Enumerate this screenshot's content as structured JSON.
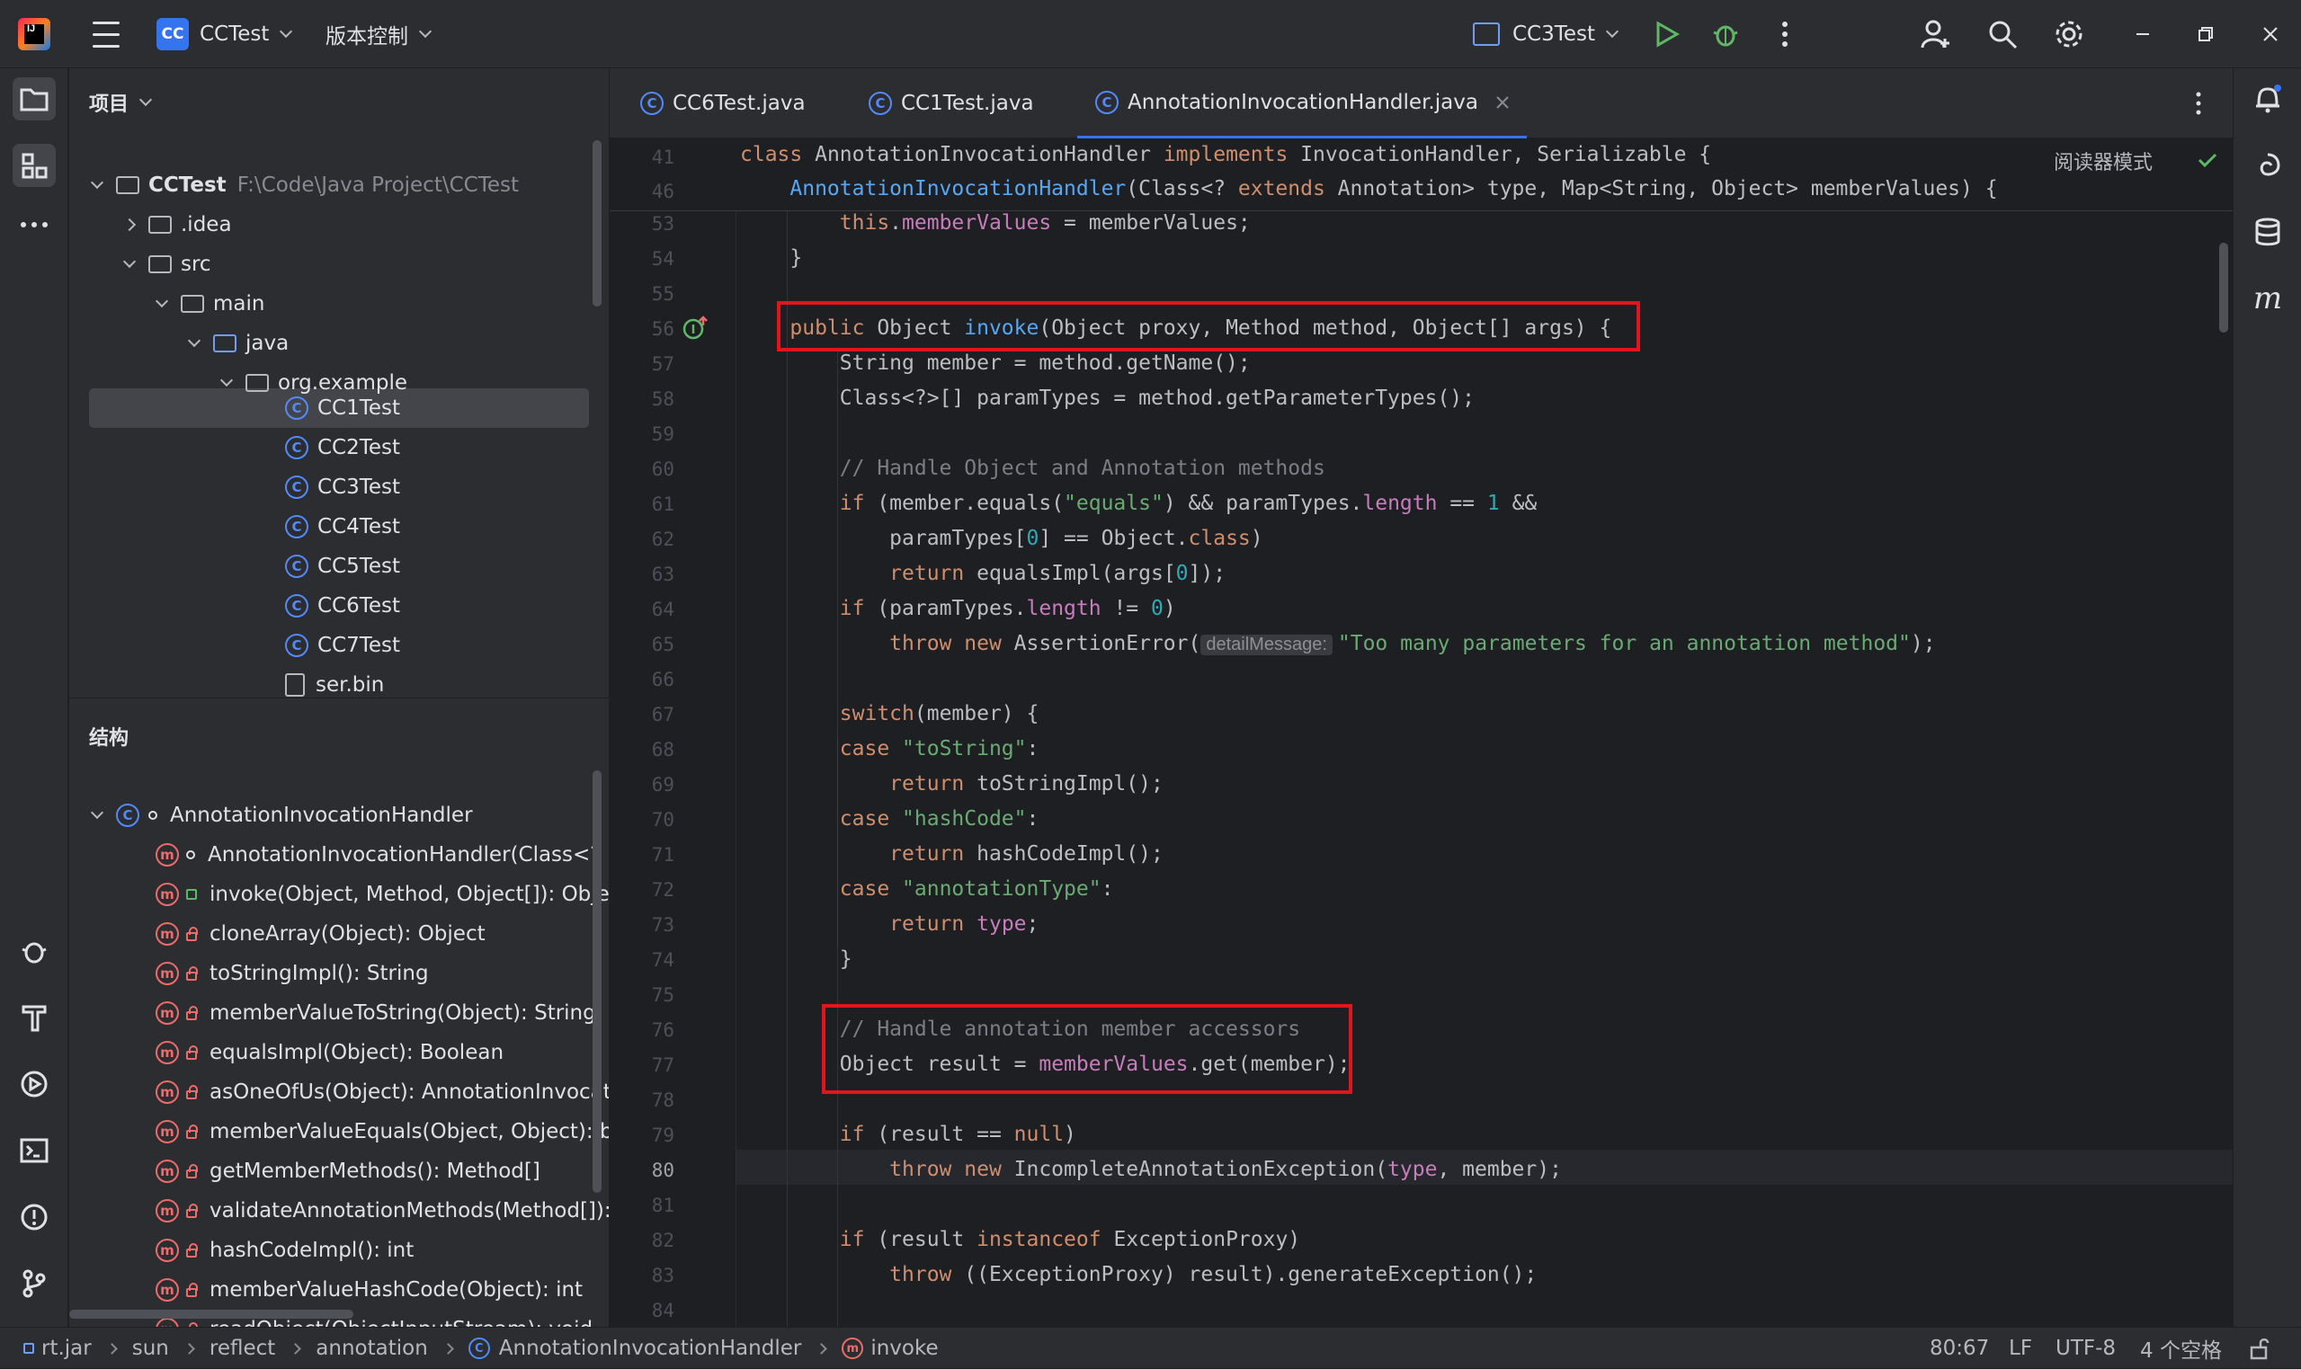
{
  "titlebar": {
    "project_badge": "CC",
    "project_name": "CCTest",
    "vcs_menu": "版本控制",
    "run_config": "CC3Test"
  },
  "project_panel": {
    "title": "项目",
    "root": {
      "name": "CCTest",
      "path": "F:\\Code\\Java Project\\CCTest"
    },
    "items": [
      {
        "label": ".idea"
      },
      {
        "label": "src"
      },
      {
        "label": "main"
      },
      {
        "label": "java"
      },
      {
        "label": "org.example"
      },
      {
        "label": "CC1Test"
      },
      {
        "label": "CC2Test"
      },
      {
        "label": "CC3Test"
      },
      {
        "label": "CC4Test"
      },
      {
        "label": "CC5Test"
      },
      {
        "label": "CC6Test"
      },
      {
        "label": "CC7Test"
      },
      {
        "label": "ser.bin"
      }
    ]
  },
  "structure_panel": {
    "title": "结构",
    "root": "AnnotationInvocationHandler",
    "members": [
      "AnnotationInvocationHandler(Class<? exte",
      "invoke(Object, Method, Object[]): Object",
      "cloneArray(Object): Object",
      "toStringImpl(): String",
      "memberValueToString(Object): String",
      "equalsImpl(Object): Boolean",
      "asOneOfUs(Object): AnnotationInvocation",
      "memberValueEquals(Object, Object): bool",
      "getMemberMethods(): Method[]",
      "validateAnnotationMethods(Method[]): vo",
      "hashCodeImpl(): int",
      "memberValueHashCode(Object): int",
      "readObject(ObjectInputStream): void"
    ]
  },
  "editor_tabs": [
    {
      "label": "CC6Test.java"
    },
    {
      "label": "CC1Test.java"
    },
    {
      "label": "AnnotationInvocationHandler.java"
    }
  ],
  "editor": {
    "reader_mode": "阅读器模式",
    "sticky_lines": [
      "41",
      "46"
    ],
    "line_numbers": [
      "53",
      "54",
      "55",
      "56",
      "57",
      "58",
      "59",
      "60",
      "61",
      "62",
      "63",
      "64",
      "65",
      "66",
      "67",
      "68",
      "69",
      "70",
      "71",
      "72",
      "73",
      "74",
      "75",
      "76",
      "77",
      "78",
      "79",
      "80",
      "81",
      "82",
      "83",
      "84"
    ],
    "param_hint": "detailMessage:"
  },
  "statusbar": {
    "breadcrumbs": [
      "rt.jar",
      "sun",
      "reflect",
      "annotation",
      "AnnotationInvocationHandler",
      "invoke"
    ],
    "position": "80:67",
    "line_sep": "LF",
    "encoding": "UTF-8",
    "indent": "4 个空格"
  }
}
